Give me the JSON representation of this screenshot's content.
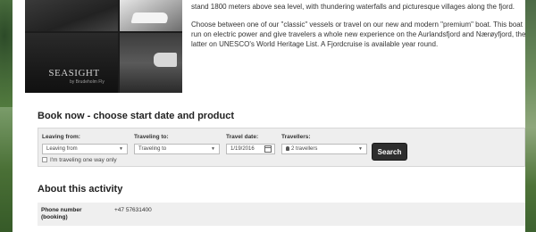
{
  "content": {
    "paragraph_1_line": "stand 1800 meters above sea level, with thundering waterfalls and picturesque villages along the fjord.",
    "paragraph_2": "Choose between one of our \"classic\" vessels or travel on our new and modern \"premium\" boat. This boat run on electric power and give travelers a whole new experience on the Aurlandsfjord and Nærøyfjord, the latter on UNESCO's World Heritage List. A Fjordcruise is available year round."
  },
  "collage": {
    "logo_text": "SEASIGHT",
    "logo_sub": "by Brudeholm Fly"
  },
  "booking": {
    "title": "Book now - choose start date and product",
    "leaving_from_label": "Leaving from:",
    "leaving_from_value": "Leaving from",
    "traveling_to_label": "Traveling to:",
    "traveling_to_value": "Traveling to",
    "travel_date_label": "Travel date:",
    "travel_date_value": "1/19/2016",
    "travellers_label": "Travellers:",
    "travellers_value": "2 travellers",
    "one_way_label": "I'm traveling one way only",
    "search_label": "Search"
  },
  "about": {
    "title": "About this activity",
    "rows": [
      {
        "label": "Phone number (booking)",
        "value": "+47 57631400"
      }
    ]
  },
  "icons": [
    "calendar-icon",
    "person-icon",
    "chevron-down-icon",
    "checkbox"
  ]
}
